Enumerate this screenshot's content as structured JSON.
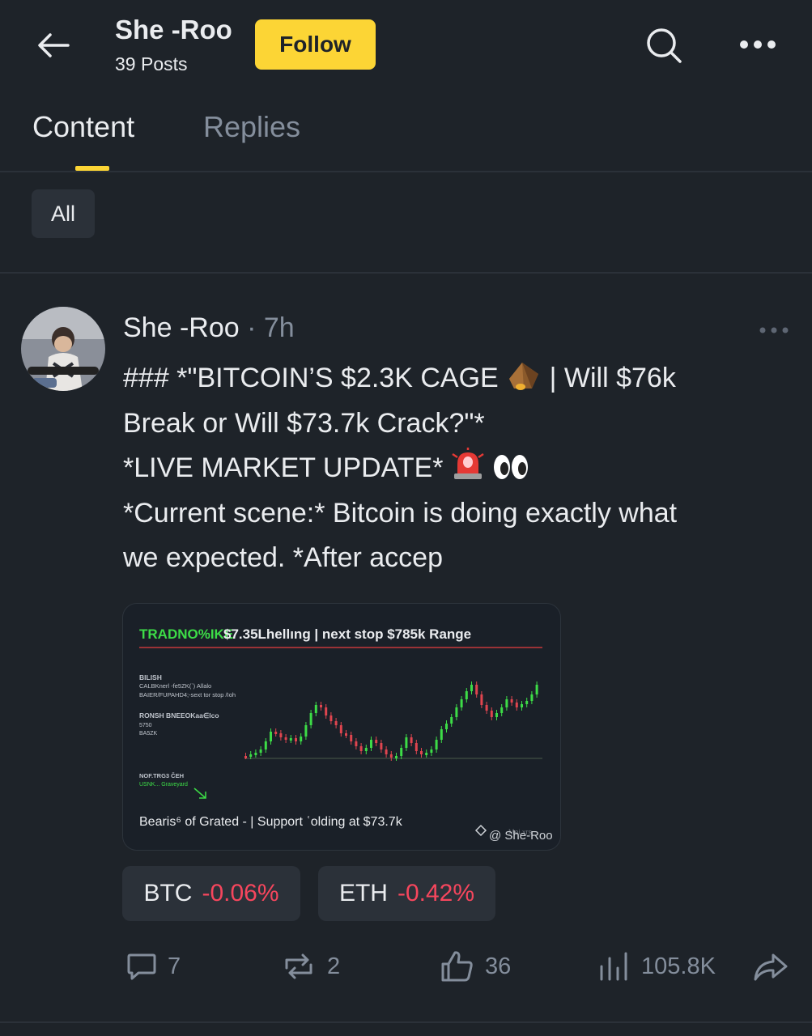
{
  "header": {
    "title": "She -Roo",
    "posts_count": "39 Posts",
    "follow_label": "Follow"
  },
  "tabs": [
    {
      "label": "Content",
      "active": true
    },
    {
      "label": "Replies",
      "active": false
    }
  ],
  "filter": {
    "label": "All"
  },
  "post": {
    "author": "She -Roo",
    "separator": "·",
    "time": "7h",
    "lines": [
      "### *\"BITCOIN’S $2.3K CAGE",
      "| Will $76k",
      "Break or Will $73.7k Crack?\"*",
      "*LIVE MARKET UPDATE*",
      "*Current scene:* Bitcoin is doing exactly what",
      "we expected.  *After accep"
    ],
    "image": {
      "headline_green": "TRADNO%IKE",
      "headline_white": "$7.35Lhellıng | next stop $785k Range",
      "left_text": [
        "BILISH",
        "CALBKnerl -fe5ZK(`) Allalo",
        "BAIER/FUPAHD4;-sext tor stop /Ioh",
        "RONSH  BNEEOKaa∈lco",
        "5750",
        "BA5ZK",
        "NOF.TRG3 ČEH",
        "USNK... Graveyard"
      ],
      "caption": "Bearis⁶ of Grated - | Support ʿolding  at $73.7k",
      "watermark": "@ She-Roo",
      "watermark_faint": "Mei xrs"
    },
    "tickers": [
      {
        "symbol": "BTC",
        "change": "-0.06%"
      },
      {
        "symbol": "ETH",
        "change": "-0.42%"
      }
    ],
    "actions": {
      "comments": "7",
      "reposts": "2",
      "likes": "36",
      "views": "105.8K"
    }
  },
  "colors": {
    "background": "#1e2329",
    "accent": "#fcd535",
    "negative": "#f6465d",
    "positive": "#0ecb81",
    "muted": "#848e9c"
  },
  "icons": [
    "arrow-left-icon",
    "search-icon",
    "more-horizontal-icon",
    "comment-icon",
    "repost-icon",
    "thumbs-up-icon",
    "views-bar-icon",
    "share-icon"
  ]
}
